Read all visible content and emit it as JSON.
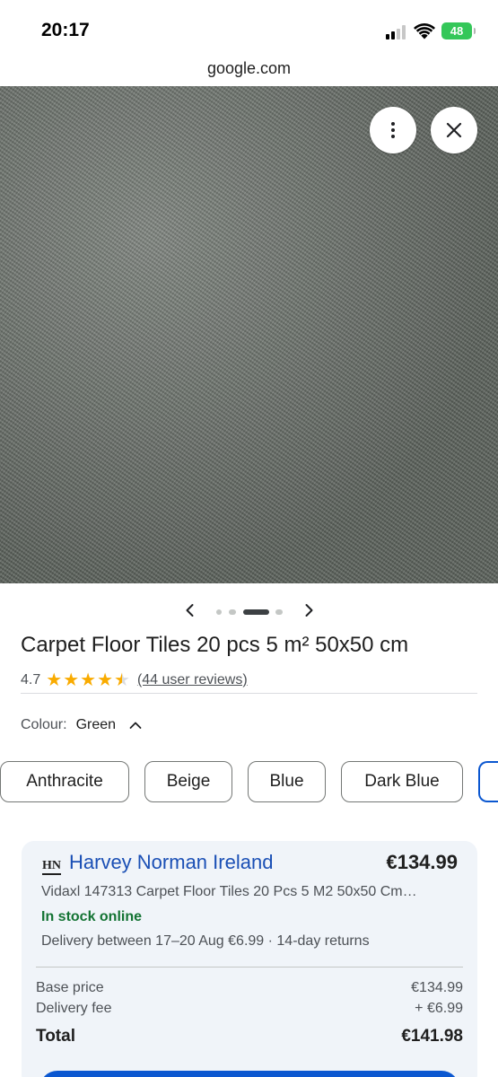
{
  "status_bar": {
    "time": "20:17",
    "battery": "48"
  },
  "browser": {
    "url": "google.com"
  },
  "image_viewer": {
    "more_icon": "more-vertical-icon",
    "close_icon": "close-icon",
    "carousel_current": 3,
    "carousel_total": 4
  },
  "product": {
    "title": "Carpet Floor Tiles 20 pcs 5 m² 50x50 cm",
    "rating": "4.7",
    "rating_value": 4.7,
    "reviews": "(44 user reviews)",
    "colour_label": "Colour:",
    "colour_value": "Green",
    "colour_options": [
      "Anthracite",
      "Beige",
      "Blue",
      "Dark Blue"
    ]
  },
  "offer": {
    "merchant_logo": "HN",
    "merchant": "Harvey Norman Ireland",
    "price": "€134.99",
    "description": "Vidaxl 147313 Carpet Floor Tiles 20 Pcs 5 M2 50x50 Cm…",
    "stock": "In stock online",
    "delivery": "Delivery between 17–20 Aug €6.99 · 14-day returns",
    "base_price_label": "Base price",
    "base_price": "€134.99",
    "delivery_fee_label": "Delivery fee",
    "delivery_fee": "+ €6.99",
    "total_label": "Total",
    "total": "€141.98"
  },
  "colors": {
    "link_blue": "#1a4fb5",
    "accent_blue": "#0b57d0",
    "stock_green": "#137333",
    "star_gold": "#f9ab00",
    "battery_green": "#34c759"
  }
}
